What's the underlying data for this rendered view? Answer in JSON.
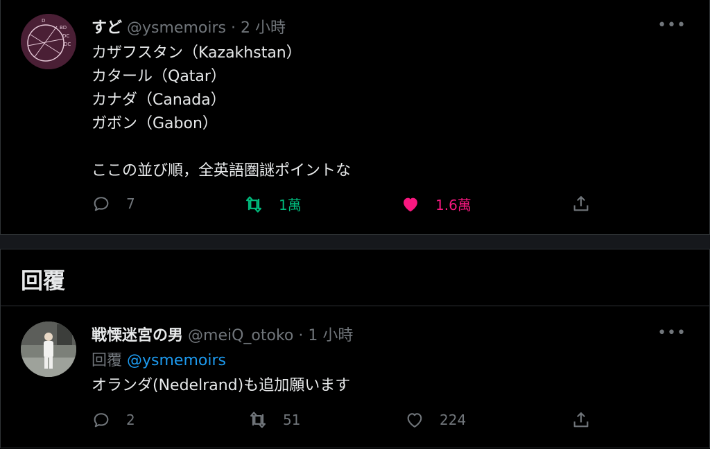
{
  "tweet": {
    "author_name": "すど",
    "handle": "@ysmemoirs",
    "time": "· 2 小時",
    "more": "•••",
    "lines": [
      "カザフスタン（Kazakhstan）",
      "カタール（Qatar）",
      "カナダ（Canada）",
      "ガボン（Gabon）",
      "",
      "ここの並び順，全英語圏謎ポイントな"
    ],
    "actions": {
      "reply_count": "7",
      "retweet_count": "1萬",
      "like_count": "1.6萬"
    }
  },
  "replies_section": {
    "title": "回覆"
  },
  "reply": {
    "author_name": "戦慄迷宮の男",
    "handle": "@meiQ_otoko",
    "time": "· 1 小時",
    "more": "•••",
    "replying_label": "回覆",
    "replying_to": "@ysmemoirs",
    "text": "オランダ(Nedelrand)も追加願います",
    "actions": {
      "reply_count": "2",
      "retweet_count": "51",
      "like_count": "224"
    }
  },
  "colors": {
    "background": "#000000",
    "retweet_active": "#00ba7c",
    "like_active": "#f91880",
    "link": "#1d9bf0",
    "muted": "#71767b"
  }
}
